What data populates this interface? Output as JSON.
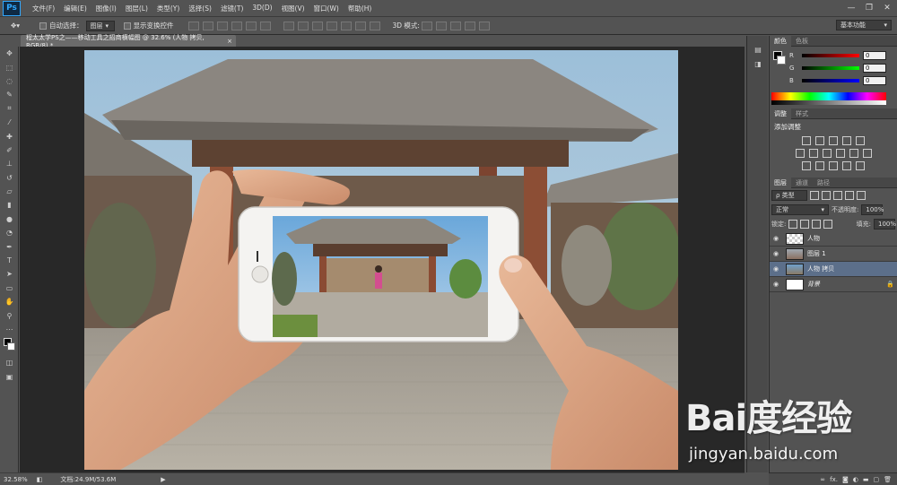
{
  "app": {
    "logo": "Ps"
  },
  "menu": [
    "文件(F)",
    "编辑(E)",
    "图像(I)",
    "图层(L)",
    "类型(Y)",
    "选择(S)",
    "滤镜(T)",
    "3D(D)",
    "视图(V)",
    "窗口(W)",
    "帮助(H)"
  ],
  "window_controls": {
    "minimize": "—",
    "restore": "❐",
    "close": "✕"
  },
  "options_bar": {
    "auto_select_label": "自动选择：",
    "auto_select_value": "图层",
    "show_transform_label": "显示变换控件",
    "mode_3d_label": "3D 模式:",
    "workspace": "基本功能"
  },
  "document_tab": {
    "title": "程太太学PS之——移动工具之招商横幅图 @ 32.6% (人物 拷贝, RGB/8) *",
    "close": "×"
  },
  "tools": [
    "move-tool",
    "marquee-tool",
    "lasso-tool",
    "quick-select-tool",
    "crop-tool",
    "eyedropper-tool",
    "healing-tool",
    "brush-tool",
    "clone-stamp-tool",
    "history-brush-tool",
    "eraser-tool",
    "gradient-tool",
    "blur-tool",
    "dodge-tool",
    "pen-tool",
    "type-tool",
    "path-select-tool",
    "shape-tool",
    "hand-tool",
    "zoom-tool"
  ],
  "status_bar": {
    "zoom": "32.58%",
    "doc_info": "文档:24.9M/53.6M"
  },
  "color_panel": {
    "tabs": [
      "颜色",
      "色板"
    ],
    "channels": [
      {
        "label": "R",
        "value": "0",
        "color": "#d02020"
      },
      {
        "label": "G",
        "value": "0",
        "color": "#20a020"
      },
      {
        "label": "B",
        "value": "0",
        "color": "#2040d0"
      }
    ]
  },
  "adjust_panel": {
    "tabs": [
      "调整",
      "样式"
    ],
    "title": "添加调整"
  },
  "layers_panel": {
    "tabs": [
      "图层",
      "通道",
      "路径"
    ],
    "filter_label": "ρ 类型",
    "blend_mode": "正常",
    "opacity_label": "不透明度:",
    "opacity_value": "100%",
    "lock_label": "锁定:",
    "fill_label": "填充:",
    "fill_value": "100%",
    "layers": [
      {
        "name": "人物",
        "selected": false,
        "locked": false
      },
      {
        "name": "图层 1",
        "selected": false,
        "locked": false
      },
      {
        "name": "人物 拷贝",
        "selected": true,
        "locked": false
      },
      {
        "name": "背景",
        "selected": false,
        "locked": true
      }
    ]
  },
  "panel_bottom_icons": [
    "link-icon",
    "fx-icon",
    "mask-icon",
    "adjust-icon",
    "folder-icon",
    "new-layer-icon",
    "trash-icon"
  ],
  "watermark": {
    "logo": "Bai度经验",
    "url": "jingyan.baidu.com"
  },
  "colors": {
    "bg": "#535353",
    "canvas": "#282828",
    "selected_layer": "#5c6f8a",
    "ps_blue": "#31a8ff"
  }
}
